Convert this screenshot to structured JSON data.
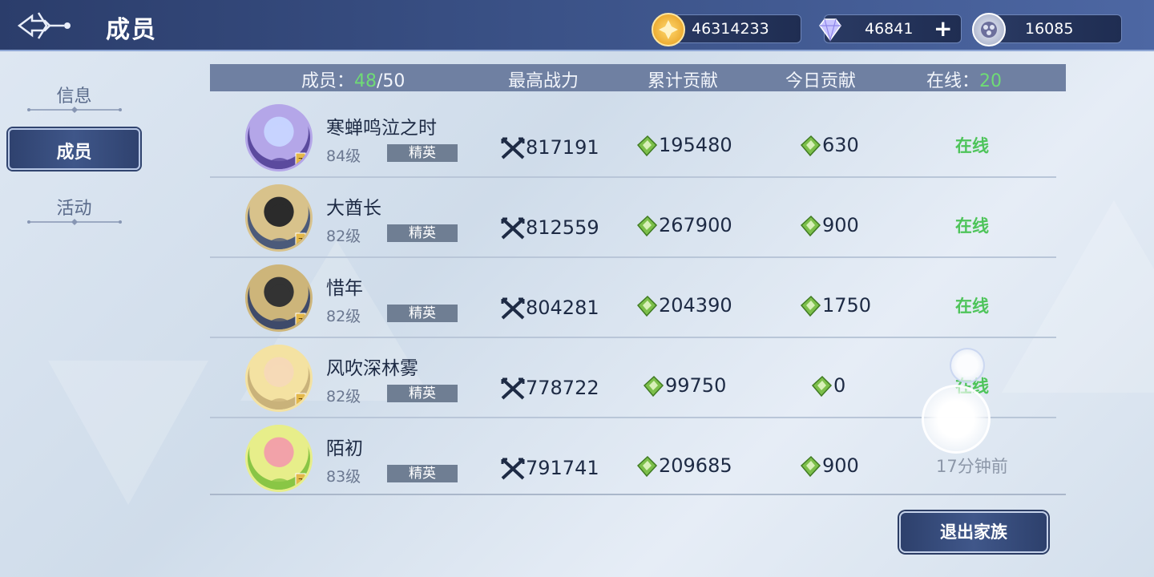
{
  "header": {
    "title": "成员",
    "currencies": [
      {
        "icon": "gold-coin-icon",
        "value": "46314233"
      },
      {
        "icon": "diamond-icon",
        "value": "46841"
      },
      {
        "icon": "token-icon",
        "value": "16085"
      }
    ]
  },
  "sidebar": {
    "items": [
      {
        "label": "信息",
        "active": false
      },
      {
        "label": "成员",
        "active": true
      },
      {
        "label": "活动",
        "active": false
      }
    ]
  },
  "table": {
    "headers": {
      "members_label": "成员：",
      "members_current": "48",
      "members_max": "/50",
      "power": "最高战力",
      "total_contrib": "累计贡献",
      "today_contrib": "今日贡献",
      "online_label": "在线：",
      "online_count": "20"
    },
    "rows": [
      {
        "name": "寒蝉鸣泣之时",
        "level": "84级",
        "rank": "精英",
        "power": "817191",
        "total": "195480",
        "today": "630",
        "status": "在线"
      },
      {
        "name": "大酋长",
        "level": "82级",
        "rank": "精英",
        "power": "812559",
        "total": "267900",
        "today": "900",
        "status": "在线"
      },
      {
        "name": "惜年",
        "level": "82级",
        "rank": "精英",
        "power": "804281",
        "total": "204390",
        "today": "1750",
        "status": "在线"
      },
      {
        "name": "风吹深林雾",
        "level": "82级",
        "rank": "精英",
        "power": "778722",
        "total": "99750",
        "today": "0",
        "status": "在线"
      },
      {
        "name": "陌初",
        "level": "83级",
        "rank": "精英",
        "power": "791741",
        "total": "209685",
        "today": "900",
        "status": "17分钟前"
      }
    ]
  },
  "exit_button": "退出家族",
  "colors": {
    "accent": "#3a5186",
    "online": "#4ec45a",
    "header_bar": "#6f80a2"
  }
}
